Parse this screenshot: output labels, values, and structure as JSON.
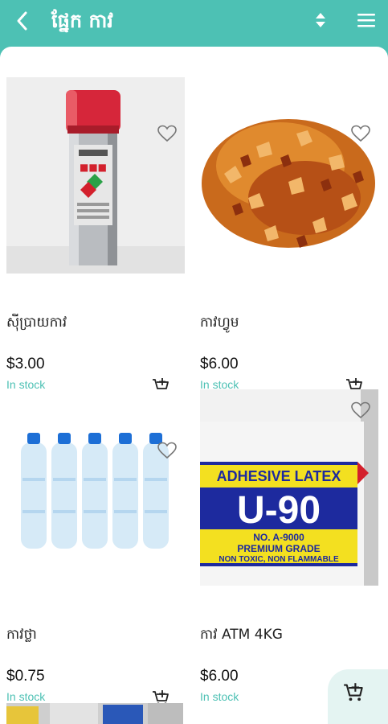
{
  "header": {
    "title": "ផ្នែក កាវ",
    "back_icon": "chevron-left-icon",
    "sort_icon": "sort-icon",
    "menu_icon": "hamburger-menu-icon"
  },
  "products": [
    {
      "name": "ស៊ីប្រាយកាវ",
      "price": "$3.00",
      "stock": "In stock",
      "image": "spray-can-image"
    },
    {
      "name": "កាវហ្វូម",
      "price": "$6.00",
      "stock": "In stock",
      "image": "resin-crystals-image"
    },
    {
      "name": "កាវថ្លា",
      "price": "$0.75",
      "stock": "In stock",
      "image": "water-bottles-image"
    },
    {
      "name": "កាវ ATM 4KG",
      "price": "$6.00",
      "stock": "In stock",
      "image": "latex-bucket-image"
    }
  ],
  "bucket_label": {
    "line1": "ADHESIVE LATEX",
    "line2": "U-90",
    "line3": "NO. A-9000",
    "line4": "PREMIUM GRADE",
    "line5": "NON TOXIC, NON FLAMMABLE"
  },
  "colors": {
    "accent": "#4dc1b4",
    "stock_text": "#4dc1b4",
    "cart_fab_bg": "#e4f4f2"
  },
  "fab": {
    "icon": "shopping-cart-icon"
  }
}
